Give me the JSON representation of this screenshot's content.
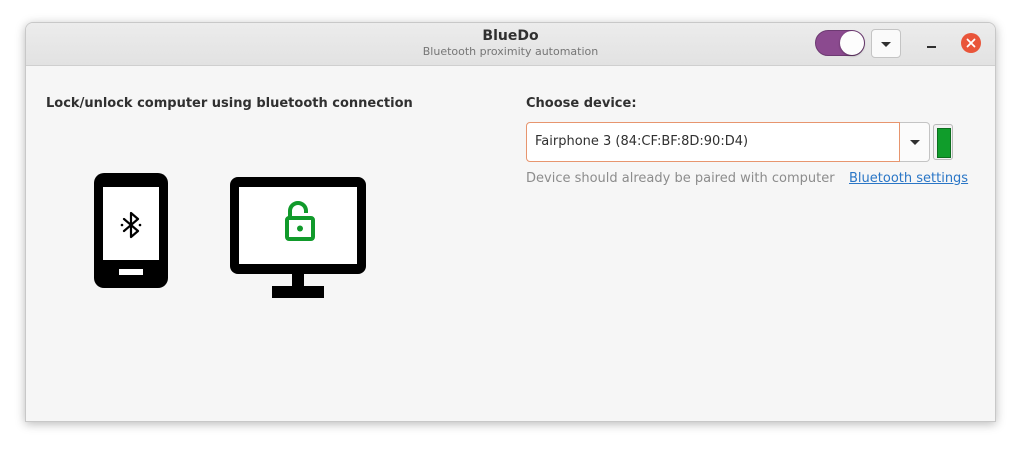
{
  "window": {
    "title": "BlueDo",
    "subtitle": "Bluetooth proximity automation",
    "enabled_toggle": true
  },
  "icons": {
    "menu": "chevron-down-icon",
    "minimize": "minimize-icon",
    "close": "close-icon",
    "phone": "smartphone-bluetooth-icon",
    "monitor": "monitor-unlocked-icon"
  },
  "left": {
    "heading": "Lock/unlock computer using bluetooth connection"
  },
  "right": {
    "label": "Choose device:",
    "selected_device": "Fairphone 3 (84:CF:BF:8D:90:D4)",
    "hint": "Device should already be paired with computer",
    "link": "Bluetooth settings",
    "status": "connected"
  },
  "colors": {
    "toggle_on": "#8b4a8f",
    "close_button": "#e9553a",
    "status_connected": "#109d2b",
    "unlock_icon": "#119a2b",
    "link": "#2a76c6",
    "entry_focus_border": "#e7956e"
  }
}
